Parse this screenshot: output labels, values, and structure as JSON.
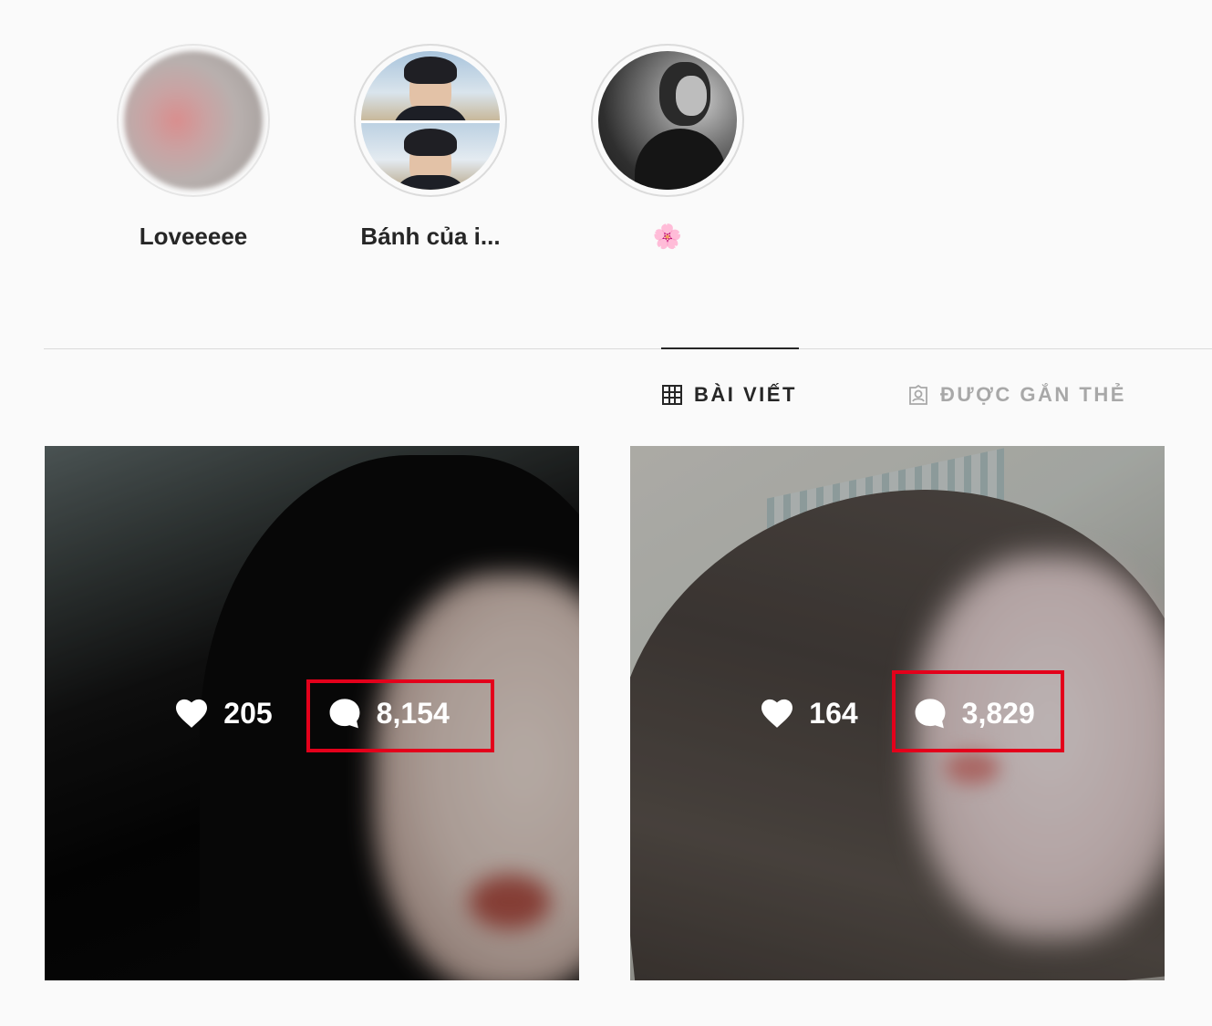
{
  "highlights": [
    {
      "label": "Loveeeee"
    },
    {
      "label": "Bánh của i..."
    },
    {
      "label": "🌸"
    }
  ],
  "tabs": {
    "posts": "BÀI VIẾT",
    "tagged": "ĐƯỢC GẮN THẺ"
  },
  "posts": [
    {
      "likes": "205",
      "comments": "8,154"
    },
    {
      "likes": "164",
      "comments": "3,829"
    }
  ],
  "colors": {
    "highlight_box": "#e3001b",
    "active_tab": "#262626",
    "inactive_tab": "#a8a8a8"
  },
  "icons": [
    "heart-icon",
    "comment-icon",
    "grid-icon",
    "tagged-icon"
  ]
}
